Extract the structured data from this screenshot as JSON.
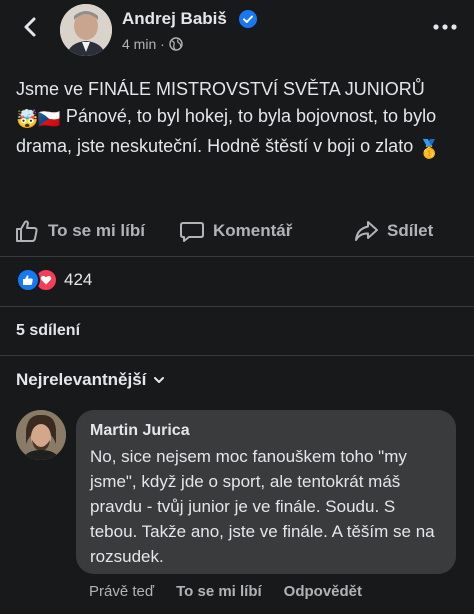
{
  "post": {
    "author": "Andrej Babiš",
    "time": "4 min ·",
    "text_line1": "Jsme ve FINÁLE MISTROVSTVÍ SVĚTA JUNIORŮ",
    "text_line2": " Pánové, to byl hokej, to byla bojovnost, to bylo drama, jste neskuteční. Hodně štěstí v boji o zlato ",
    "emojis": [
      "🤯",
      "🇨🇿",
      "🥇"
    ]
  },
  "actions": {
    "like": "To se mi líbí",
    "comment": "Komentář",
    "share": "Sdílet"
  },
  "reactions": {
    "count": "424",
    "types": [
      "like",
      "love"
    ]
  },
  "shares": "5 sdílení",
  "comments_sort": "Nejrelevantnější",
  "comment": {
    "author": "Martin Jurica",
    "text": "No, sice nejsem moc fanouškem toho \"my jsme\", když jde o sport, ale tentokrát máš pravdu - tvůj junior je ve finále. Soudu. S tebou. Takže ano, jste ve finále. A těším se na rozsudek.",
    "time": "Právě teď",
    "like": "To se mi líbí",
    "reply": "Odpovědět"
  },
  "icons": [
    "back-arrow-icon",
    "verified-badge-icon",
    "globe-icon",
    "more-icon",
    "thumbs-up-icon",
    "comment-icon",
    "share-icon",
    "like-reaction-icon",
    "love-reaction-icon",
    "chevron-down-icon"
  ],
  "colors": {
    "background": "#18191a",
    "bubble": "#3a3b3c",
    "text": "#e4e6eb",
    "muted": "#b0b3b8",
    "like": "#1877f2",
    "love": "#f33e58",
    "verified": "#1877f2"
  }
}
